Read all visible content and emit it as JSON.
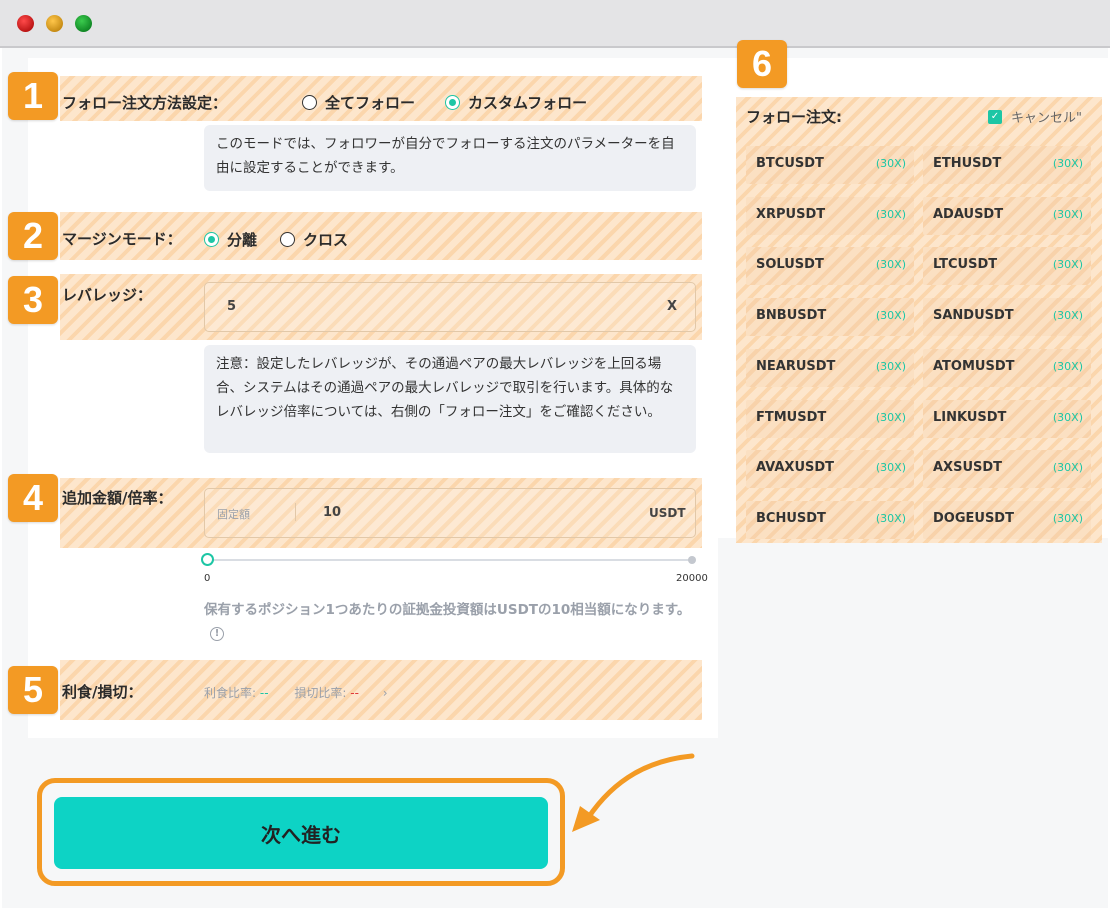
{
  "window": {
    "controls": [
      "close",
      "minimize",
      "maximize"
    ]
  },
  "colors": {
    "accent": "#1dc6a5",
    "badge": "#f39a24",
    "button": "#0dd3c5",
    "profit_value": "#1dc6a5",
    "loss_value": "#e03b3b"
  },
  "follow_method": {
    "badge": "1",
    "label": "フォロー注文方法設定：",
    "options": [
      {
        "label": "全てフォロー",
        "selected": false
      },
      {
        "label": "カスタムフォロー",
        "selected": true
      }
    ],
    "note": "このモードでは、フォロワーが自分でフォローする注文のパラメーターを自由に設定することができます。"
  },
  "margin_mode": {
    "badge": "2",
    "label": "マージンモード：",
    "options": [
      {
        "label": "分離",
        "selected": true
      },
      {
        "label": "クロス",
        "selected": false
      }
    ]
  },
  "leverage": {
    "badge": "3",
    "label": "レバレッジ：",
    "value": "5",
    "unit": "X",
    "note": "注意：設定したレバレッジが、その通過ペアの最大レバレッジを上回る場合、システムはその通過ペアの最大レバレッジで取引を行います。具体的なレバレッジ倍率については、右側の「フォロー注文」をご確認ください。"
  },
  "amount": {
    "badge": "4",
    "label": "追加金額/倍率：",
    "type_label": "固定額",
    "value": "10",
    "unit": "USDT",
    "slider": {
      "min": "0",
      "max": "20000",
      "value_fraction": 0.0
    },
    "note": "保有するポジション1つあたりの証拠金投資額はUSDTの10相当額になります。",
    "info_icon": "info-circle-icon"
  },
  "tp_sl": {
    "badge": "5",
    "label": "利食/損切：",
    "take_profit_label": "利食比率:",
    "take_profit_value": "--",
    "stop_loss_label": "損切比率:",
    "stop_loss_value": "--",
    "chevron": "›"
  },
  "follow_orders": {
    "badge": "6",
    "title": "フォロー注文:",
    "cancel_label": "キャンセル\"",
    "cancel_checked": true,
    "pairs": [
      {
        "symbol": "BTCUSDT",
        "leverage": "(30X)"
      },
      {
        "symbol": "ETHUSDT",
        "leverage": "(30X)"
      },
      {
        "symbol": "XRPUSDT",
        "leverage": "(30X)"
      },
      {
        "symbol": "ADAUSDT",
        "leverage": "(30X)"
      },
      {
        "symbol": "SOLUSDT",
        "leverage": "(30X)"
      },
      {
        "symbol": "LTCUSDT",
        "leverage": "(30X)"
      },
      {
        "symbol": "BNBUSDT",
        "leverage": "(30X)"
      },
      {
        "symbol": "SANDUSDT",
        "leverage": "(30X)"
      },
      {
        "symbol": "NEARUSDT",
        "leverage": "(30X)"
      },
      {
        "symbol": "ATOMUSDT",
        "leverage": "(30X)"
      },
      {
        "symbol": "FTMUSDT",
        "leverage": "(30X)"
      },
      {
        "symbol": "LINKUSDT",
        "leverage": "(30X)"
      },
      {
        "symbol": "AVAXUSDT",
        "leverage": "(30X)"
      },
      {
        "symbol": "AXSUSDT",
        "leverage": "(30X)"
      },
      {
        "symbol": "BCHUSDT",
        "leverage": "(30X)"
      },
      {
        "symbol": "DOGEUSDT",
        "leverage": "(30X)"
      }
    ]
  },
  "next_button": {
    "label": "次へ進む"
  }
}
